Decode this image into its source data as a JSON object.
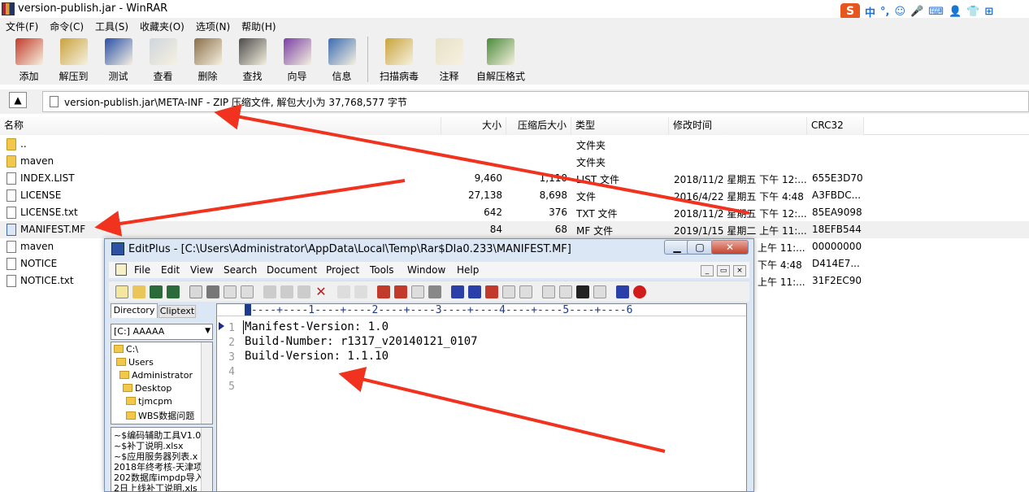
{
  "window": {
    "title": "version-publish.jar - WinRAR"
  },
  "ime": {
    "brand": "S",
    "items": [
      "中",
      "°,",
      "☺",
      "🎤",
      "⌨",
      "👤",
      "👕",
      "⊞"
    ]
  },
  "menu": [
    "文件(F)",
    "命令(C)",
    "工具(S)",
    "收藏夹(O)",
    "选项(N)",
    "帮助(H)"
  ],
  "toolbar": [
    {
      "label": "添加",
      "icon": "add-icon",
      "color": "#c23b2a"
    },
    {
      "label": "解压到",
      "icon": "extract-to-icon",
      "color": "#c9a23c"
    },
    {
      "label": "测试",
      "icon": "test-icon",
      "color": "#2a4fa8"
    },
    {
      "label": "查看",
      "icon": "view-icon",
      "color": "#cfd5dd"
    },
    {
      "label": "删除",
      "icon": "delete-icon",
      "color": "#8a6f4a"
    },
    {
      "label": "查找",
      "icon": "find-icon",
      "color": "#4a4a4a"
    },
    {
      "label": "向导",
      "icon": "wizard-icon",
      "color": "#7a3fa3"
    },
    {
      "label": "信息",
      "icon": "info-icon",
      "color": "#3b6bb1"
    },
    {
      "label": "扫描病毒",
      "icon": "scan-virus-icon",
      "color": "#caa43a"
    },
    {
      "label": "注释",
      "icon": "comment-icon",
      "color": "#e8e1c8"
    },
    {
      "label": "自解压格式",
      "icon": "sfx-icon",
      "color": "#4a8a3a"
    }
  ],
  "address": {
    "path": "version-publish.jar\\META-INF - ZIP 压缩文件, 解包大小为 37,768,577 字节"
  },
  "columns": {
    "name": "名称",
    "size": "大小",
    "packed": "压缩后大小",
    "type": "类型",
    "modified": "修改时间",
    "crc": "CRC32"
  },
  "rows": [
    {
      "name": "..",
      "size": "",
      "packed": "",
      "type": "文件夹",
      "modified": "",
      "crc": "",
      "icon": "folder-icon"
    },
    {
      "name": "maven",
      "size": "",
      "packed": "",
      "type": "文件夹",
      "modified": "",
      "crc": "",
      "icon": "folder-icon"
    },
    {
      "name": "INDEX.LIST",
      "size": "9,460",
      "packed": "1,110",
      "type": "LIST 文件",
      "modified": "2018/11/2 星期五 下午 12:...",
      "crc": "655E3D70",
      "icon": "file-icon"
    },
    {
      "name": "LICENSE",
      "size": "27,138",
      "packed": "8,698",
      "type": "文件",
      "modified": "2016/4/22 星期五 下午 4:48",
      "crc": "A3FBDC...",
      "icon": "file-icon"
    },
    {
      "name": "LICENSE.txt",
      "size": "642",
      "packed": "376",
      "type": "TXT 文件",
      "modified": "2018/11/2 星期五 下午 12:...",
      "crc": "85EA9098",
      "icon": "file-icon"
    },
    {
      "name": "MANIFEST.MF",
      "size": "84",
      "packed": "68",
      "type": "MF 文件",
      "modified": "2019/1/15 星期二 上午 11:...",
      "crc": "18EFB544",
      "icon": "mf-file-icon",
      "selected": true
    },
    {
      "name": "maven",
      "size": "",
      "packed": "",
      "type": "",
      "modified": "上午 11:...",
      "crc": "00000000",
      "icon": "file-icon"
    },
    {
      "name": "NOTICE",
      "size": "",
      "packed": "",
      "type": "",
      "modified": "下午 4:48",
      "crc": "D414E7...",
      "icon": "file-icon"
    },
    {
      "name": "NOTICE.txt",
      "size": "",
      "packed": "",
      "type": "",
      "modified": "上午 11:...",
      "crc": "31F2EC90",
      "icon": "file-icon"
    }
  ],
  "editplus": {
    "title": "EditPlus - [C:\\Users\\Administrator\\AppData\\Local\\Temp\\Rar$DIa0.233\\MANIFEST.MF]",
    "win_buttons": [
      "▁",
      "▢",
      "✕"
    ],
    "mdi_buttons": [
      "_",
      "▭",
      "×"
    ],
    "menu": [
      "File",
      "Edit",
      "View",
      "Search",
      "Document",
      "Project",
      "Tools",
      "Window",
      "Help"
    ],
    "tabs": {
      "directory": "Directory",
      "cliptext": "Cliptext"
    },
    "drive": "[C:] AAAAA",
    "tree": [
      "C:\\",
      "Users",
      "Administrator",
      "Desktop",
      "tjmcpm",
      "WBS数据问题"
    ],
    "files": [
      "~$编码辅助工具V1.0",
      "~$补丁说明.xlsx",
      "~$应用服务器列表.x",
      "2018年终考核-天津项",
      "202数据库impdp导入",
      "2日上线补丁说明.xls"
    ],
    "ruler": "----+----1----+----2----+----3----+----4----+----5----+----6",
    "lines": [
      "Manifest-Version: 1.0",
      "Build-Number: r1317_v20140121_0107",
      "Build-Version: 1.1.10",
      "",
      ""
    ],
    "line_numbers": [
      "1",
      "2",
      "3",
      "4",
      "5"
    ]
  },
  "colors": {
    "arrow": "#f0321e",
    "selection": "#f0f0f0",
    "editplus_frame": "#dce7f5"
  }
}
